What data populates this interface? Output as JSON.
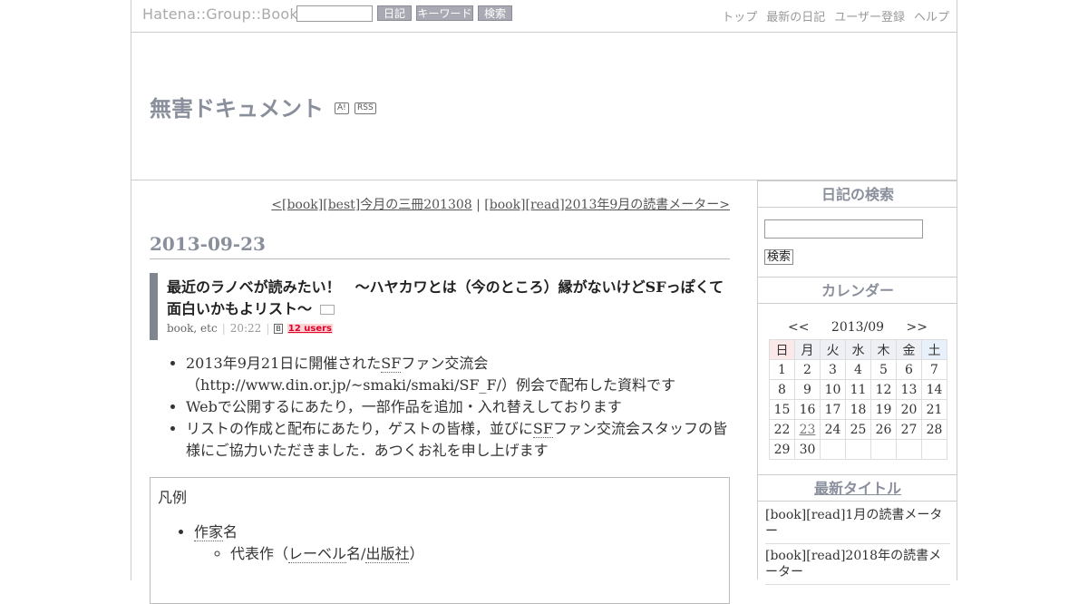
{
  "topbar": {
    "logo": "Hatena::Group::Book",
    "buttons": [
      "日記",
      "キーワード",
      "検索"
    ],
    "nav": [
      "トップ",
      "最新の日記",
      "ユーザー登録",
      "ヘルプ"
    ]
  },
  "header": {
    "title": "無害ドキュメント",
    "badges": [
      "A!",
      "RSS"
    ]
  },
  "main": {
    "pager": {
      "prev": "<[book][best]今月の三冊201308",
      "separator": "|",
      "next": "[book][read]2013年9月の読書メーター>"
    },
    "date": "2013-09-23",
    "section": {
      "title": "最近のラノベが読みたい！　～ハヤカワとは（今のところ）縁がないけどSFっぽくて面白いかもよリスト～",
      "categories": "book, etc",
      "time": "20:22",
      "bookmark_users": "12 users"
    },
    "list": [
      {
        "pre": "2013年9月21日に開催された",
        "abbr": "SF",
        "mid": "ファン交流会（",
        "link": "http://www.din.or.jp/~smaki/smaki/SF_F/",
        "post": "）例会で配布した資料です"
      },
      {
        "text": "Webで公開するにあたり，一部作品を追加・入れ替えしております"
      },
      {
        "pre": "リストの作成と配布にあたり，ゲストの皆様，並びに",
        "abbr": "SF",
        "post": "ファン交流会スタッフの皆様にご協力いただきました．あつくお礼を申し上げます"
      }
    ],
    "legend": {
      "title": "凡例",
      "author_prefix": "作家",
      "author_suffix": "名",
      "work_pre": "代表作（",
      "label": "レーベル",
      "work_mid": "名/",
      "publisher": "出版社",
      "work_post": "）"
    }
  },
  "sidebar": {
    "search_heading": "日記の検索",
    "search_button": "検索",
    "calendar_heading": "カレンダー",
    "calendar_prev": "<<",
    "calendar_month": "2013/09",
    "calendar_next": ">>",
    "weekdays": [
      "日",
      "月",
      "火",
      "水",
      "木",
      "金",
      "土"
    ],
    "weeks": [
      [
        "1",
        "2",
        "3",
        "4",
        "5",
        "6",
        "7"
      ],
      [
        "8",
        "9",
        "10",
        "11",
        "12",
        "13",
        "14"
      ],
      [
        "15",
        "16",
        "17",
        "18",
        "19",
        "20",
        "21"
      ],
      [
        "22",
        "23",
        "24",
        "25",
        "26",
        "27",
        "28"
      ],
      [
        "29",
        "30",
        "",
        "",
        "",
        "",
        ""
      ]
    ],
    "linked_day": "23",
    "recent_heading": "最新タイトル",
    "recent": [
      "[book][read]1月の読書メーター",
      "[book][read]2018年の読書メーター"
    ]
  }
}
